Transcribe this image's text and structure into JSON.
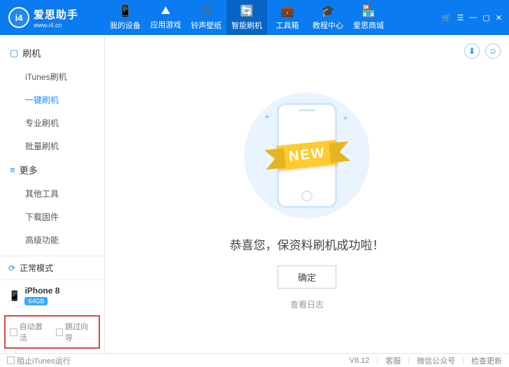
{
  "app": {
    "name": "爱思助手",
    "url": "www.i4.cn",
    "logo_text": "i4"
  },
  "top_nav": [
    {
      "icon": "📱",
      "label": "我的设备"
    },
    {
      "icon": "⛰",
      "label": "应用游戏"
    },
    {
      "icon": "🎵",
      "label": "铃声壁纸"
    },
    {
      "icon": "🔄",
      "label": "智能刷机",
      "active": true
    },
    {
      "icon": "💼",
      "label": "工具箱"
    },
    {
      "icon": "🎓",
      "label": "教程中心"
    },
    {
      "icon": "🏪",
      "label": "爱思商城"
    }
  ],
  "sidebar": {
    "sections": [
      {
        "icon": "▢",
        "title": "刷机",
        "items": [
          {
            "label": "iTunes刷机"
          },
          {
            "label": "一键刷机",
            "active": true
          },
          {
            "label": "专业刷机"
          },
          {
            "label": "批量刷机"
          }
        ]
      },
      {
        "icon": "≡",
        "title": "更多",
        "items": [
          {
            "label": "其他工具"
          },
          {
            "label": "下载固件"
          },
          {
            "label": "高级功能"
          }
        ]
      }
    ],
    "status": {
      "label": "正常模式"
    },
    "device": {
      "name": "iPhone 8",
      "storage": "64GB"
    },
    "checks": [
      {
        "label": "自动激活"
      },
      {
        "label": "跳过向导"
      }
    ]
  },
  "main": {
    "ribbon": "NEW",
    "success_text": "恭喜您，保资料刷机成功啦！",
    "ok_button": "确定",
    "log_link": "查看日志"
  },
  "footer": {
    "block_itunes": "阻止iTunes运行",
    "version": "V8.12",
    "links": [
      "客服",
      "微信公众号",
      "检查更新"
    ]
  }
}
